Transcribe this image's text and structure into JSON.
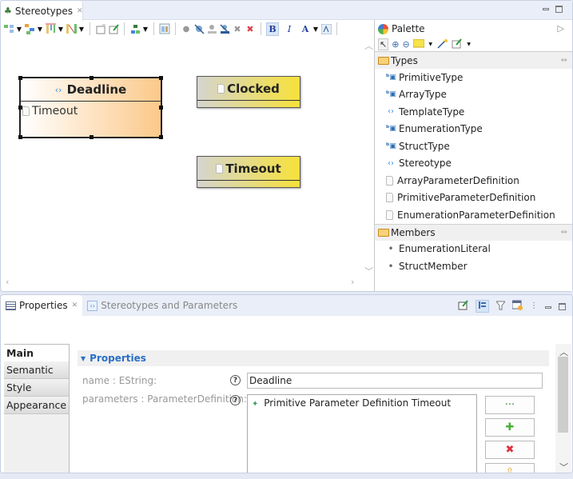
{
  "editor": {
    "tab": {
      "icon": "stereotypes-diagram-icon",
      "label": "Stereotypes",
      "close": "✕"
    },
    "window_controls": [
      "minimize",
      "maximize"
    ],
    "toolbar": {
      "groups": [
        [
          "arrange-all-icon",
          "arrange-selection-icon",
          "align-icon",
          "distribute-icon"
        ],
        [
          "edit-properties-icon",
          "new-note-icon"
        ],
        [
          "layer-icon"
        ],
        [
          "refresh-icon"
        ],
        [
          "show-element-icon",
          "hide-element-icon",
          "show-label-icon",
          "hide-label-icon",
          "delete-from-diagram-icon",
          "delete-from-model-icon"
        ],
        [
          "bold-icon",
          "italic-icon",
          "font-color-icon",
          "fill-color-icon"
        ]
      ],
      "bold": "B",
      "italic": "I",
      "font_color": "A"
    }
  },
  "diagram": {
    "nodes": [
      {
        "name": "Deadline",
        "kind": "stereotype",
        "selected": true,
        "attributes": [
          "Timeout"
        ]
      },
      {
        "name": "Clocked",
        "kind": "primitive-parameter-definition",
        "selected": false,
        "attributes": []
      },
      {
        "name": "Timeout",
        "kind": "primitive-parameter-definition",
        "selected": false,
        "attributes": []
      }
    ]
  },
  "palette": {
    "title": "Palette",
    "tools": [
      "select-icon",
      "zoom-in-icon",
      "zoom-out-icon",
      "note-icon",
      "connection-icon",
      "attachment-icon"
    ],
    "drawers": [
      {
        "label": "Types",
        "items": [
          {
            "label": "PrimitiveType",
            "icon": "primitive-type-icon"
          },
          {
            "label": "ArrayType",
            "icon": "primitive-type-icon"
          },
          {
            "label": "TemplateType",
            "icon": "stereotype-icon"
          },
          {
            "label": "EnumerationType",
            "icon": "primitive-type-icon"
          },
          {
            "label": "StructType",
            "icon": "primitive-type-icon"
          },
          {
            "label": "Stereotype",
            "icon": "stereotype-icon"
          },
          {
            "label": "ArrayParameterDefinition",
            "icon": "file-icon"
          },
          {
            "label": "PrimitiveParameterDefinition",
            "icon": "file-icon"
          },
          {
            "label": "EnumerationParameterDefinition",
            "icon": "file-icon"
          }
        ]
      },
      {
        "label": "Members",
        "items": [
          {
            "label": "EnumerationLiteral",
            "icon": "bullet-icon"
          },
          {
            "label": "StructMember",
            "icon": "bullet-icon"
          }
        ]
      }
    ]
  },
  "properties": {
    "tabs": [
      {
        "label": "Properties",
        "active": true,
        "close": "✕"
      },
      {
        "label": "Stereotypes and Parameters",
        "active": false
      }
    ],
    "side_tabs": [
      "Main",
      "Semantic",
      "Style",
      "Appearance"
    ],
    "section_title": "Properties",
    "fields": {
      "name_label": "name : EString:",
      "name_value": "Deadline",
      "parameters_label": "parameters : ParameterDefinition:",
      "parameters_items": [
        "Primitive Parameter Definition Timeout"
      ]
    },
    "help": "?",
    "buttons": {
      "browse": "···",
      "add": "✚",
      "remove": "✖",
      "up": "⇧"
    }
  }
}
